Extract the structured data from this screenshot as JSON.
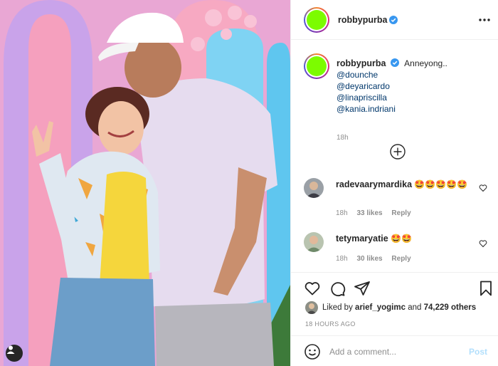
{
  "post": {
    "username": "robbypurba",
    "verified": true,
    "colors": {
      "avatar_fill": "#7cfc00",
      "link": "#00376b",
      "muted": "#8e8e8e",
      "post_disabled": "#b2dffc",
      "verified_blue": "#3897f0"
    }
  },
  "caption": {
    "username": "robbypurba",
    "text": "Anneyong..",
    "mentions": [
      "@dounche",
      "@deyaricardo",
      "@linapriscilla",
      "@kania.indriani"
    ],
    "time": "18h"
  },
  "comments": [
    {
      "username": "radevaarymardika",
      "text": "🤩🤩🤩🤩🤩",
      "time": "18h",
      "likes": "33 likes",
      "reply": "Reply"
    },
    {
      "username": "tetymaryatie",
      "text": "🤩🤩",
      "time": "18h",
      "likes": "30 likes",
      "reply": "Reply"
    }
  ],
  "likes": {
    "prefix": "Liked by",
    "user": "arief_yogimc",
    "joiner": "and",
    "count": "74,229 others"
  },
  "timestamp": "18 HOURS AGO",
  "add_comment": {
    "placeholder": "Add a comment...",
    "post_label": "Post"
  },
  "icons": {
    "more": "more-options-icon",
    "load_more": "plus-circle-icon",
    "like": "heart-icon",
    "comment": "comment-icon",
    "share": "paper-plane-icon",
    "save": "bookmark-icon",
    "emoji": "smiley-icon",
    "tag": "user-tag-icon"
  }
}
